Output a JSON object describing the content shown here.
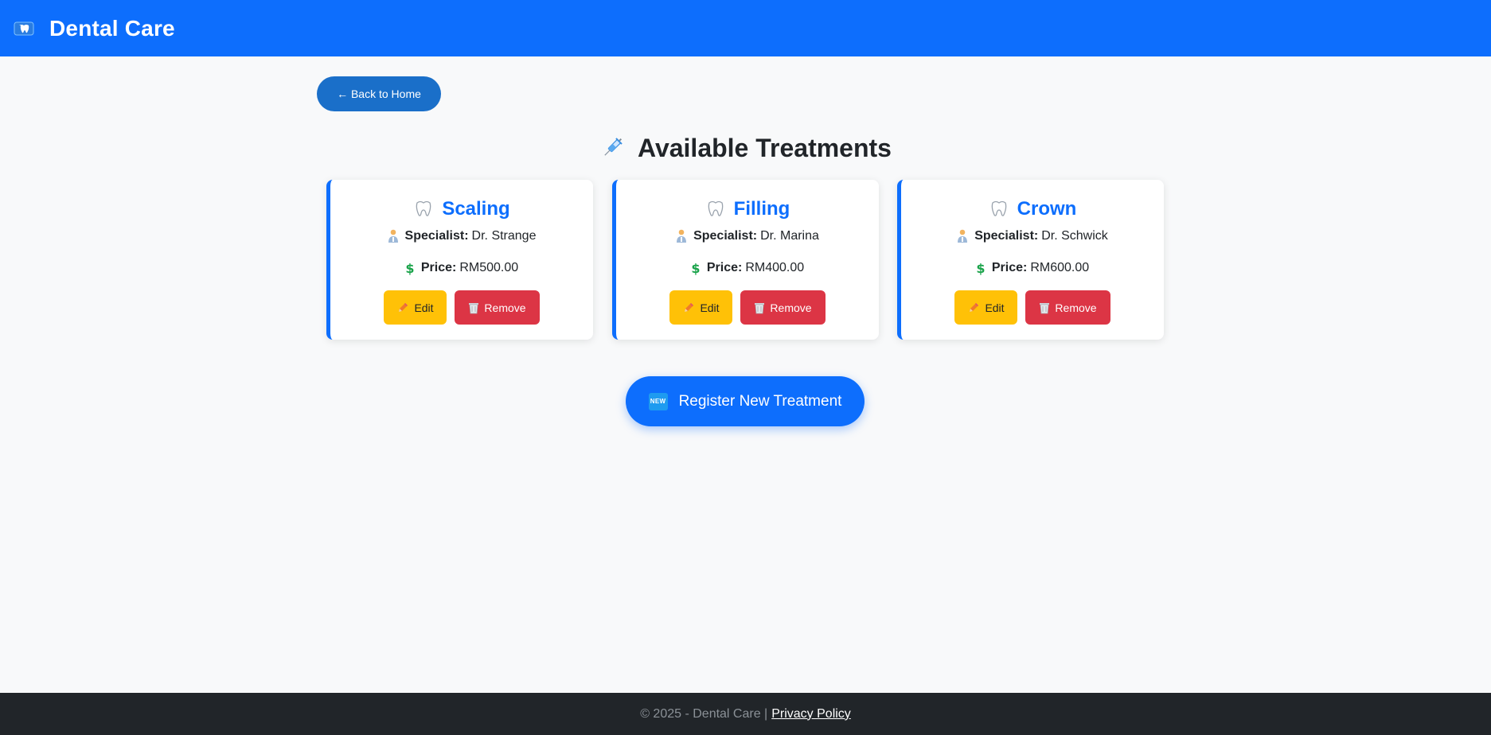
{
  "navbar": {
    "brand_title": "Dental Care",
    "logo_icon": "tooth-logo-icon",
    "background": "#0d6efd"
  },
  "back_button": {
    "label": "← Back to Home"
  },
  "heading": {
    "icon": "syringe-icon",
    "title": "Available Treatments"
  },
  "treatments": [
    {
      "name": "Scaling",
      "specialist_label": "Specialist:",
      "specialist": "Dr. Strange",
      "price_label": "Price:",
      "price": "RM500.00",
      "edit_label": "Edit",
      "remove_label": "Remove"
    },
    {
      "name": "Filling",
      "specialist_label": "Specialist:",
      "specialist": "Dr. Marina",
      "price_label": "Price:",
      "price": "RM400.00",
      "edit_label": "Edit",
      "remove_label": "Remove"
    },
    {
      "name": "Crown",
      "specialist_label": "Specialist:",
      "specialist": "Dr. Schwick",
      "price_label": "Price:",
      "price": "RM600.00",
      "edit_label": "Edit",
      "remove_label": "Remove"
    }
  ],
  "register_button": {
    "badge": "NEW",
    "label": "Register New Treatment"
  },
  "footer": {
    "text": "© 2025 - Dental Care |",
    "link": "Privacy Policy"
  },
  "colors": {
    "primary": "#0d6efd",
    "warning": "#ffc107",
    "danger": "#dc3545",
    "dark": "#212529",
    "background": "#f8f9fa"
  }
}
